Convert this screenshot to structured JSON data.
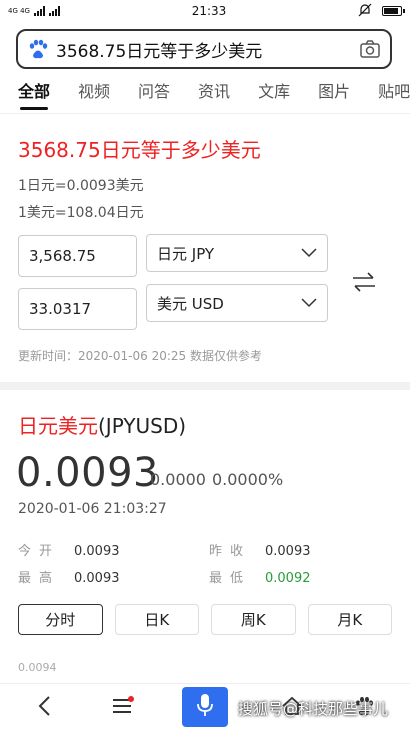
{
  "status_bar": {
    "network": "4G 4G",
    "time": "21:33"
  },
  "search": {
    "query": "3568.75日元等于多少美元"
  },
  "tabs": [
    {
      "label": "全部"
    },
    {
      "label": "视频"
    },
    {
      "label": "问答"
    },
    {
      "label": "资讯"
    },
    {
      "label": "文库"
    },
    {
      "label": "图片"
    },
    {
      "label": "贴吧"
    }
  ],
  "converter": {
    "title": "3568.75日元等于多少美元",
    "rate1": "1日元=0.0093美元",
    "rate2": "1美元=108.04日元",
    "amount_from": "3,568.75",
    "currency_from": "日元 JPY",
    "amount_to": "33.0317",
    "currency_to": "美元 USD",
    "update_label": "更新时间：",
    "update_time": "2020-01-06 20:25",
    "update_note": "数据仅供参考"
  },
  "quote": {
    "title_cn": "日元美元",
    "title_code": "(JPYUSD)",
    "price": "0.0093",
    "change": "0.0000",
    "change_pct": "0.0000%",
    "time": "2020-01-06 21:03:27",
    "stats": {
      "open_label": "今开",
      "open": "0.0093",
      "prev_close_label": "昨收",
      "prev_close": "0.0093",
      "high_label": "最高",
      "high": "0.0093",
      "low_label": "最低",
      "low": "0.0092"
    },
    "periods": [
      {
        "label": "分时"
      },
      {
        "label": "日K"
      },
      {
        "label": "周K"
      },
      {
        "label": "月K"
      }
    ],
    "chart_top_label": "0.0094"
  },
  "watermark": "搜狐号@科技那些事儿",
  "colors": {
    "accent_red": "#e22222",
    "brand_blue": "#2f6fef",
    "low_green": "#2a9a3a"
  }
}
